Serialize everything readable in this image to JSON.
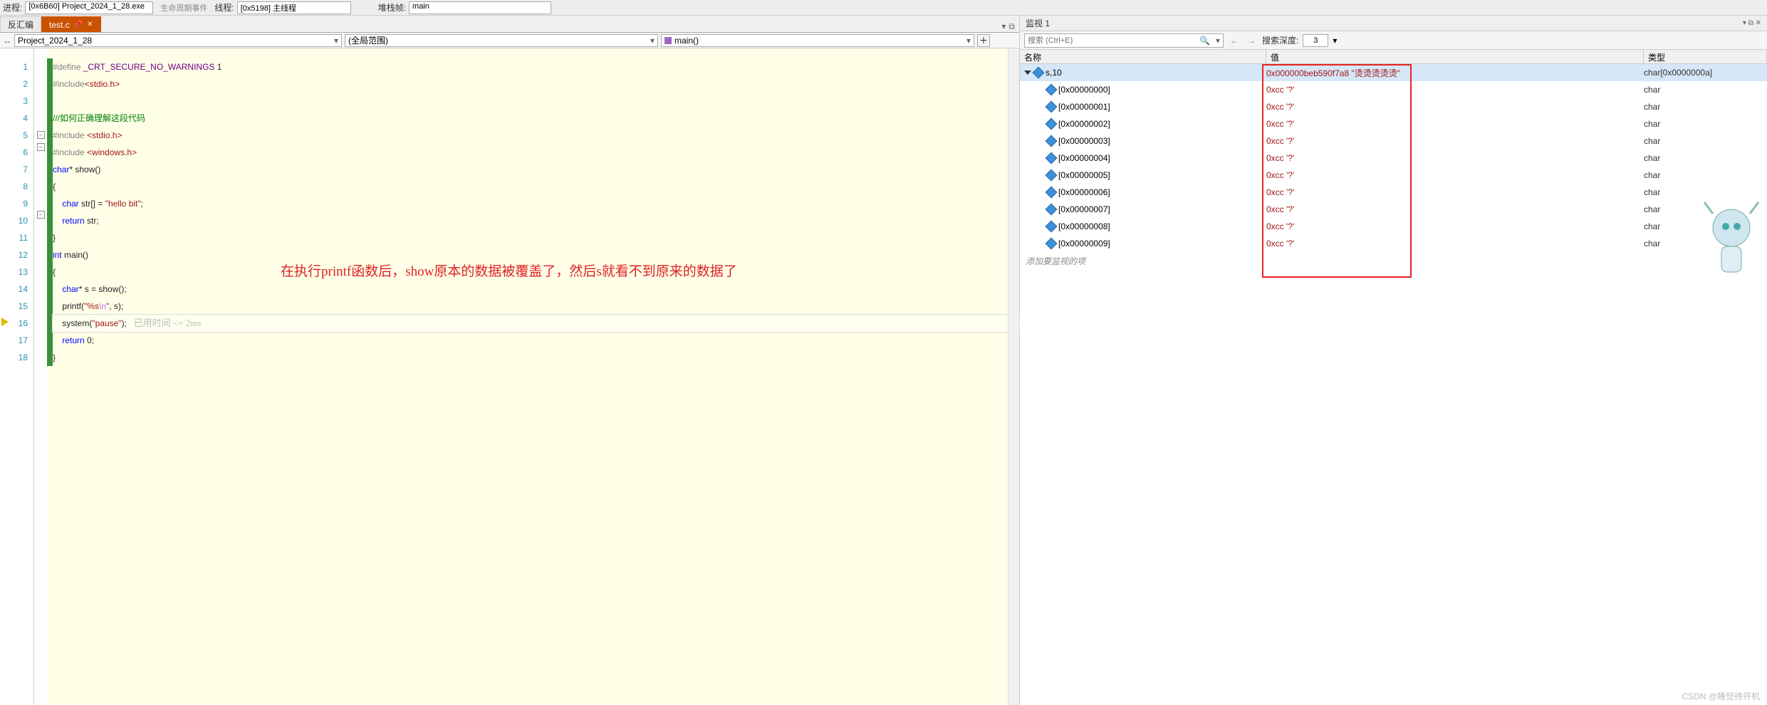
{
  "toolbar": {
    "process_label": "进程:",
    "process_value": "[0x6B60] Project_2024_1_28.exe",
    "lifecycle_btn": "生命周期事件",
    "thread_label": "线程:",
    "thread_value": "[0x5198] 主线程",
    "stackframe_label": "堆栈帧:",
    "stackframe_value": "main"
  },
  "tabs": {
    "inactive": "反汇编",
    "active": "test.c"
  },
  "nav": {
    "scope": "Project_2024_1_28",
    "filter": "(全局范围)",
    "func": "main()"
  },
  "code": {
    "l1_a": "#define ",
    "l1_b": "_CRT_SECURE_NO_WARNINGS",
    "l1_c": " 1",
    "l2_a": "#include",
    "l2_b": "<stdio.h>",
    "l4": "///如何正确理解这段代码",
    "l5_a": "#include ",
    "l5_b": "<stdio.h>",
    "l6_a": "#include ",
    "l6_b": "<windows.h>",
    "l7_a": "char",
    "l7_b": "* show()",
    "l8": "{",
    "l9_a": "    char",
    "l9_b": " str[] = ",
    "l9_c": "\"hello bit\"",
    "l9_d": ";",
    "l10_a": "    return",
    "l10_b": " str;",
    "l11": "}",
    "l12_a": "int",
    "l12_b": " main()",
    "l13": "{",
    "l14_a": "    char",
    "l14_b": "* s = show();",
    "l15_a": "    printf(",
    "l15_b": "\"%s",
    "l15_c": "\\n",
    "l15_d": "\"",
    "l15_e": ", s);",
    "l16_a": "    system(",
    "l16_b": "\"pause\"",
    "l16_c": ");",
    "l16_hint": "   已用时间 <= 2ms",
    "l17_a": "    return",
    "l17_b": " 0;",
    "l18": "}"
  },
  "annotation": "在执行printf函数后，show原本的数据被覆盖了，然后s就看不到原来的数据了",
  "watch": {
    "panel_title": "监视 1",
    "search_placeholder": "搜索 (Ctrl+E)",
    "depth_label": "搜索深度:",
    "depth_value": "3",
    "col_name": "名称",
    "col_value": "值",
    "col_type": "类型",
    "root": {
      "name": "s,10",
      "value": "0x000000beb590f7a8 \"烫烫烫烫烫\"",
      "type": "char[0x0000000a]"
    },
    "items": [
      {
        "name": "[0x00000000]",
        "value": "0xcc '?'",
        "type": "char"
      },
      {
        "name": "[0x00000001]",
        "value": "0xcc '?'",
        "type": "char"
      },
      {
        "name": "[0x00000002]",
        "value": "0xcc '?'",
        "type": "char"
      },
      {
        "name": "[0x00000003]",
        "value": "0xcc '?'",
        "type": "char"
      },
      {
        "name": "[0x00000004]",
        "value": "0xcc '?'",
        "type": "char"
      },
      {
        "name": "[0x00000005]",
        "value": "0xcc '?'",
        "type": "char"
      },
      {
        "name": "[0x00000006]",
        "value": "0xcc '?'",
        "type": "char"
      },
      {
        "name": "[0x00000007]",
        "value": "0xcc '?'",
        "type": "char"
      },
      {
        "name": "[0x00000008]",
        "value": "0xcc '?'",
        "type": "char"
      },
      {
        "name": "[0x00000009]",
        "value": "0xcc '?'",
        "type": "char"
      }
    ],
    "add_prompt": "添加要监视的项"
  },
  "watermark": "CSDN @睡觉待开机"
}
